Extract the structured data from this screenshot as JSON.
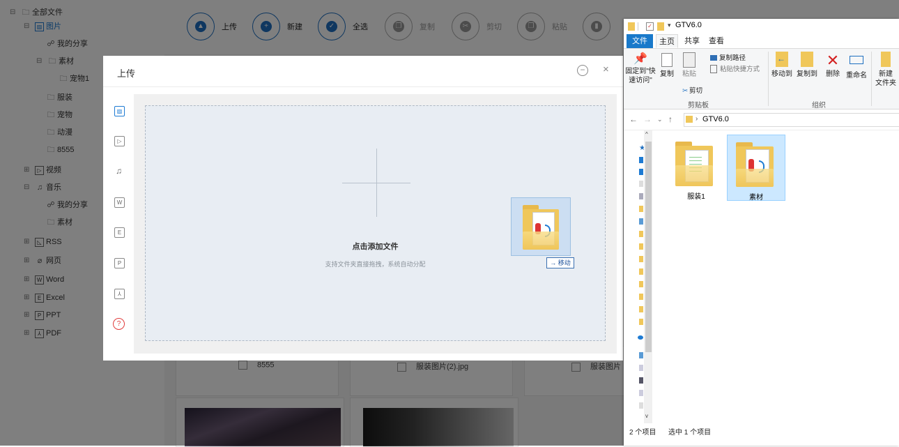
{
  "sidebar": {
    "root": "全部文件",
    "items": [
      {
        "label": "图片",
        "icon": "image-icon"
      },
      {
        "label": "我的分享",
        "icon": "share-icon"
      },
      {
        "label": "素材",
        "icon": "folder-icon"
      },
      {
        "label": "宠物1",
        "icon": "folder-icon"
      },
      {
        "label": "服装",
        "icon": "folder-icon"
      },
      {
        "label": "宠物",
        "icon": "folder-icon"
      },
      {
        "label": "动漫",
        "icon": "folder-icon"
      },
      {
        "label": "8555",
        "icon": "folder-icon"
      },
      {
        "label": "视频",
        "icon": "video-icon"
      },
      {
        "label": "音乐",
        "icon": "music-icon"
      },
      {
        "label": "我的分享",
        "icon": "share-icon"
      },
      {
        "label": "素材",
        "icon": "folder-icon"
      },
      {
        "label": "RSS",
        "icon": "rss-icon"
      },
      {
        "label": "网页",
        "icon": "web-icon"
      },
      {
        "label": "Word",
        "icon": "word-icon"
      },
      {
        "label": "Excel",
        "icon": "excel-icon"
      },
      {
        "label": "PPT",
        "icon": "ppt-icon"
      },
      {
        "label": "PDF",
        "icon": "pdf-icon"
      }
    ]
  },
  "toolbar": {
    "upload": "上传",
    "new": "新建",
    "select_all": "全选",
    "copy": "复制",
    "cut": "剪切",
    "paste": "粘贴"
  },
  "files": [
    {
      "name": "8555"
    },
    {
      "name": "服装图片(2).jpg"
    },
    {
      "name": "服装图片"
    }
  ],
  "dialog": {
    "title": "上传",
    "minimize": "−",
    "close": "×",
    "help": "?",
    "drop_title": "点击添加文件",
    "drop_hint": "支持文件夹直接拖拽，系统自动分配",
    "move_badge": "→ 移动",
    "side_icons": [
      "image-icon",
      "video-icon",
      "music-icon",
      "word-icon",
      "excel-icon",
      "ppt-icon",
      "pdf-icon"
    ]
  },
  "explorer": {
    "title": "GTV6.0",
    "tabs": [
      "文件",
      "主页",
      "共享",
      "查看"
    ],
    "ribbon": {
      "pin": "固定到\"快速访问\"",
      "copy": "复制",
      "paste": "粘贴",
      "copy_path": "复制路径",
      "paste_shortcut": "粘贴快捷方式",
      "cut": "剪切",
      "clipboard_group": "剪贴板",
      "move_to": "移动到",
      "copy_to": "复制到",
      "delete": "删除",
      "rename": "重命名",
      "organize_group": "组织",
      "new_folder": "新建\n文件夹"
    },
    "path": "GTV6.0",
    "items": [
      {
        "name": "服装1",
        "selected": false
      },
      {
        "name": "素材",
        "selected": true
      }
    ],
    "status": {
      "count": "2 个项目",
      "selected": "选中 1 个项目"
    }
  }
}
